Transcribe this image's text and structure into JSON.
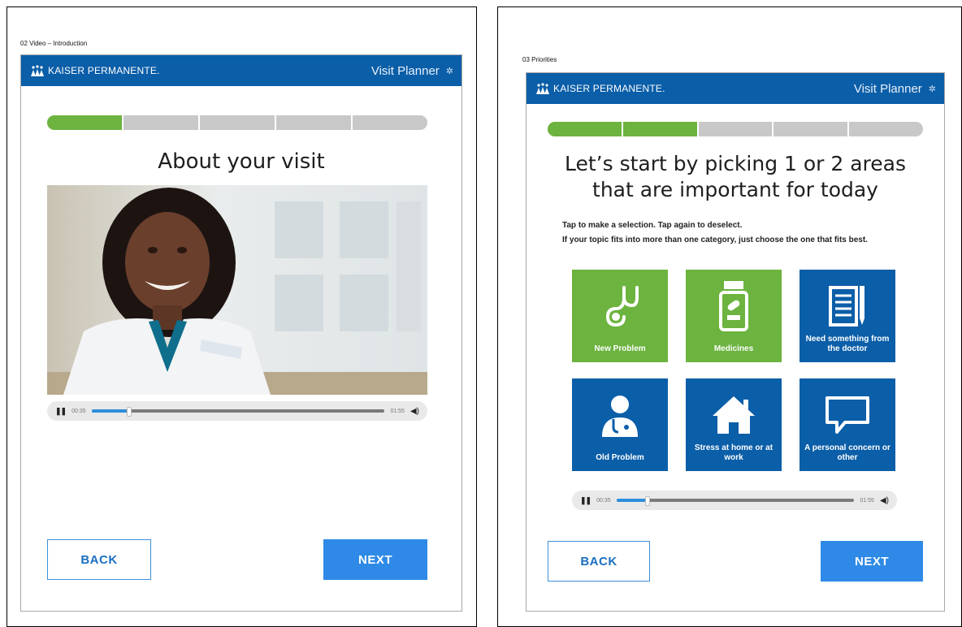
{
  "screens": [
    {
      "label": "02 Video – Introduction",
      "brand": "KAISER PERMANENTE.",
      "app_title": "Visit Planner",
      "progress": {
        "completed": 1,
        "total": 5
      },
      "heading": "About your visit",
      "player": {
        "current": "00:35",
        "duration": "01:55",
        "progress": 0.12
      },
      "back": "BACK",
      "next": "NEXT"
    },
    {
      "label": "03 Priorities",
      "brand": "KAISER PERMANENTE.",
      "app_title": "Visit Planner",
      "progress": {
        "completed": 2,
        "total": 5
      },
      "heading_line1": "Let’s start by picking 1 or 2 areas",
      "heading_line2": "that are important for today",
      "instruction1": "Tap to make a selection. Tap again to deselect.",
      "instruction2": "If your topic fits into more than one category, just choose the one that fits best.",
      "tiles": [
        {
          "label": "New Problem",
          "icon": "stethoscope-icon",
          "color": "#6cb33f"
        },
        {
          "label": "Medicines",
          "icon": "pill-bottle-icon",
          "color": "#6cb33f"
        },
        {
          "label": "Need something from the doctor",
          "icon": "notepad-icon",
          "color": "#0b5ea8"
        },
        {
          "label": "Old Problem",
          "icon": "doctor-icon",
          "color": "#0b5ea8"
        },
        {
          "label": "Stress at home or at work",
          "icon": "house-icon",
          "color": "#0b5ea8"
        },
        {
          "label": "A personal concern or other",
          "icon": "speech-bubble-icon",
          "color": "#0b5ea8"
        }
      ],
      "player": {
        "current": "00:35",
        "duration": "01:55",
        "progress": 0.12
      },
      "back": "BACK",
      "next": "NEXT"
    }
  ]
}
